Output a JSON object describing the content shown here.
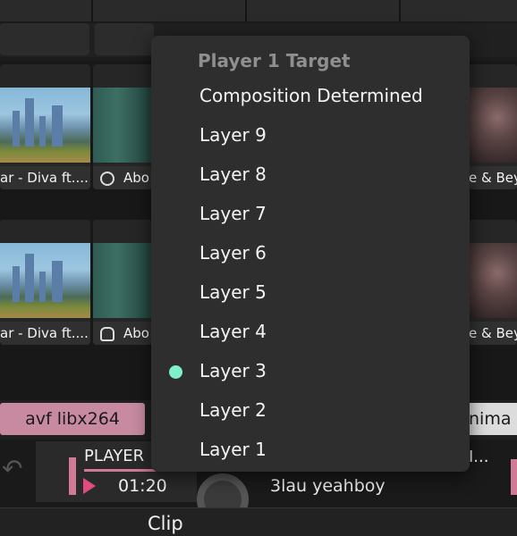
{
  "clips": {
    "row1": [
      {
        "label": "ar - Diva ft...."
      },
      {
        "label": "Abo"
      },
      {
        "label": "e & Beyo"
      }
    ],
    "row2": [
      {
        "label": "ar - Diva ft...."
      },
      {
        "label": "Abo"
      },
      {
        "label": "e & Beyo"
      }
    ]
  },
  "layer_bar": {
    "codec_label": "avf libx264",
    "right_label": "nima"
  },
  "player": {
    "title": "PLAYER",
    "time": "01:20",
    "track": "3lau yeahboy",
    "right_title": "I...",
    "progress": 0.5
  },
  "footer": {
    "label": "Clip"
  },
  "menu": {
    "header": "Player 1 Target",
    "items": [
      {
        "label": "Composition Determined",
        "selected": false
      },
      {
        "label": "Layer 9",
        "selected": false
      },
      {
        "label": "Layer 8",
        "selected": false
      },
      {
        "label": "Layer 7",
        "selected": false
      },
      {
        "label": "Layer 6",
        "selected": false
      },
      {
        "label": "Layer 5",
        "selected": false
      },
      {
        "label": "Layer 4",
        "selected": false
      },
      {
        "label": "Layer 3",
        "selected": true
      },
      {
        "label": "Layer 2",
        "selected": false
      },
      {
        "label": "Layer 1",
        "selected": false
      }
    ]
  },
  "colors": {
    "accent_pink": "#d07a95",
    "selected_dot": "#7ff0c9",
    "menu_bg": "#2e2e2e"
  }
}
